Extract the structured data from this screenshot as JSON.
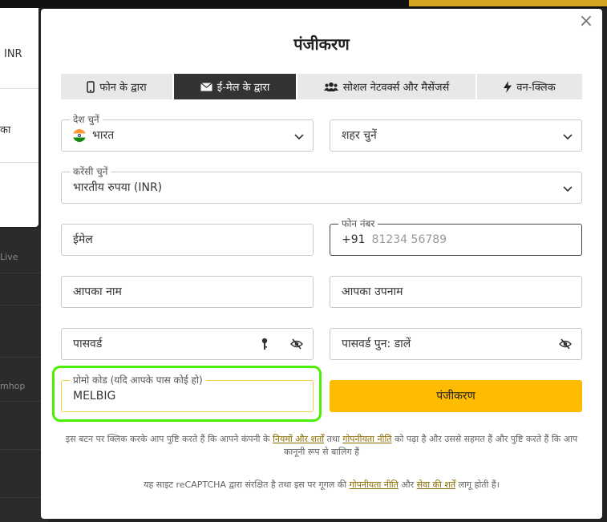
{
  "background": {
    "currency_label": "INR",
    "side_text": "का",
    "row_text_1": "Live",
    "row_text_2": "mhop"
  },
  "modal": {
    "title": "पंजीकरण",
    "close_symbol": "×",
    "tabs": [
      {
        "label": "फोन के द्वारा",
        "icon": "phone-icon",
        "active": false
      },
      {
        "label": "ई-मेल के द्वारा",
        "icon": "envelope-icon",
        "active": true
      },
      {
        "label": "सोशल नेटवर्क्स और मैसेंजर्स",
        "icon": "users-icon",
        "active": false
      },
      {
        "label": "वन-क्लिक",
        "icon": "lightning-icon",
        "active": false
      }
    ],
    "country": {
      "label": "देश चुनें",
      "value": "भारत"
    },
    "city": {
      "placeholder": "शहर चुनें"
    },
    "currency": {
      "label": "करेंसी चुनें",
      "value": "भारतीय रुपया (INR)"
    },
    "email": {
      "placeholder": "ईमेल"
    },
    "phone": {
      "label": "फोन नंबर",
      "prefix": "+91",
      "placeholder": "81234 56789"
    },
    "first_name": {
      "placeholder": "आपका नाम"
    },
    "last_name": {
      "placeholder": "आपका उपनाम"
    },
    "password": {
      "placeholder": "पासवर्ड"
    },
    "password_confirm": {
      "placeholder": "पासवर्ड पुन: डालें"
    },
    "promo": {
      "label": "प्रोमो कोड (यदि आपके पास कोई हो)",
      "value": "MELBIG"
    },
    "register_button": "पंजीकरण",
    "legal": {
      "part1": "इस बटन पर क्लिक करके आप पुष्टि करते हैं कि आपने कंपनी के ",
      "terms_link": "नियमों और शर्तों",
      "part2": " तथा ",
      "privacy_link": "गोपनीयता नीति",
      "part3": " को पढ़ा है और उससे सहमत हैं और पुष्टि करते हैं कि आप कानूनी रूप से बालिग हैं"
    },
    "recaptcha": {
      "part1": "यह साइट reCAPTCHA द्वारा संरक्षित है तथा इस पर गूगल की ",
      "privacy_link": "गोपनीयता नीति",
      "part2": " और ",
      "terms_link": "सेवा की शर्तें",
      "part3": " लागू होती हैं।"
    }
  },
  "colors": {
    "accent": "#ffbb00",
    "active_tab": "#333333",
    "highlight_ring": "#4cf000"
  }
}
